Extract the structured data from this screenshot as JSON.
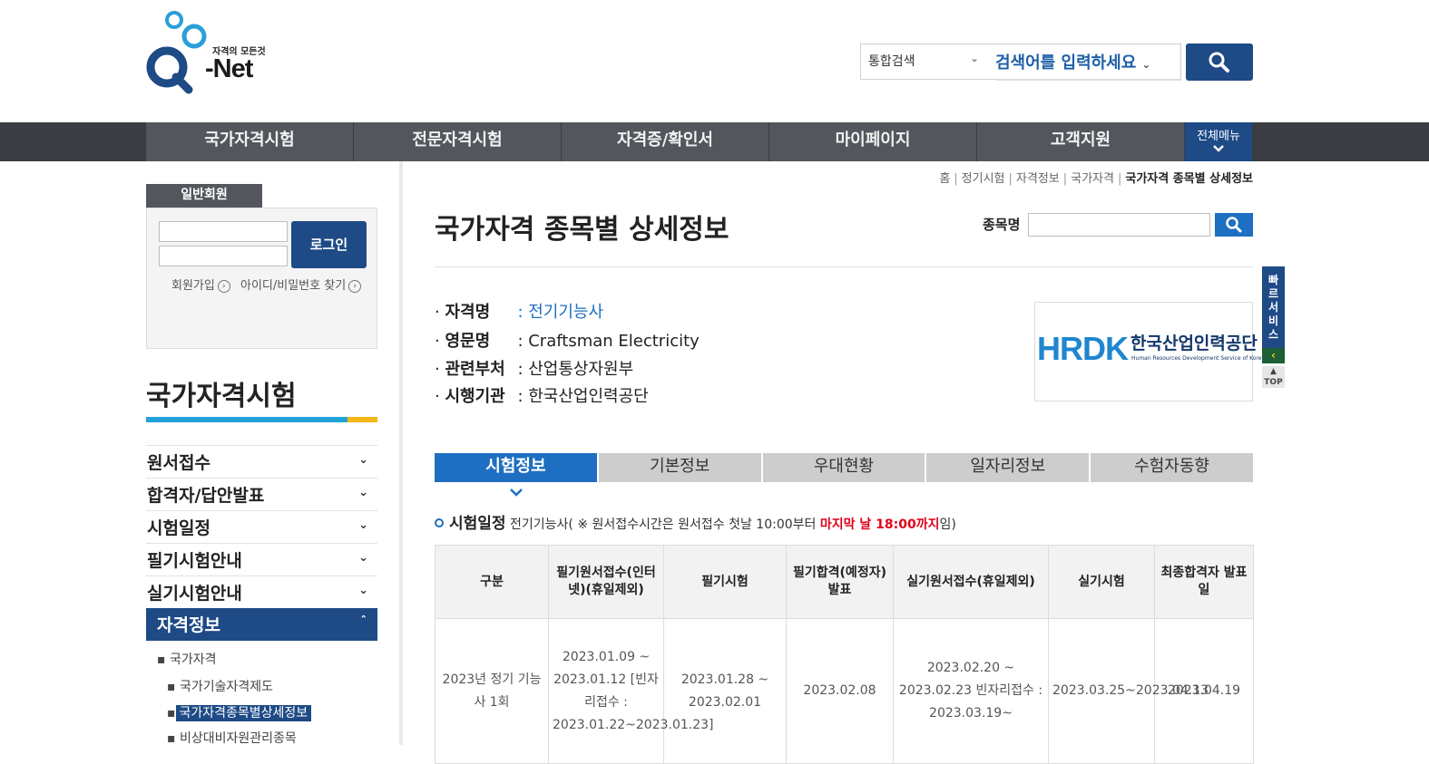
{
  "header": {
    "logo_tagline": "자격의 모든것",
    "logo_text": "-Net",
    "search_scope": "통합검색",
    "search_placeholder": "검색어를 입력하세요"
  },
  "gnb": {
    "items": [
      "국가자격시험",
      "전문자격시험",
      "자격증/확인서",
      "마이페이지",
      "고객지원"
    ],
    "all_menu": "전체메뉴"
  },
  "sidebar": {
    "login_label": "일반회원",
    "login_button": "로그인",
    "signup_link": "회원가입",
    "find_link": "아이디/비밀번호 찾기",
    "section_title": "국가자격시험",
    "menu": [
      "원서접수",
      "합격자/답안발표",
      "시험일정",
      "필기시험안내",
      "실기시험안내"
    ],
    "active_menu": "자격정보",
    "sub_items": [
      "국가자격",
      "국가기술자격제도",
      "국가자격종목별상세정보",
      "비상대비자원관리종목"
    ]
  },
  "breadcrumb": [
    "홈",
    "정기시험",
    "자격정보",
    "국가자격",
    "국가자격 종목별 상세정보"
  ],
  "main": {
    "title": "국가자격 종목별 상세정보",
    "jongmok_label": "종목명",
    "info": [
      {
        "key": "자격명",
        "value": ": 전기기능사"
      },
      {
        "key": "영문명",
        "value": ": Craftsman Electricity"
      },
      {
        "key": "관련부처",
        "value": ": 산업통상자원부"
      },
      {
        "key": "시행기관",
        "value": ": 한국산업인력공단"
      }
    ],
    "hrdk_logo_big": "HRDK",
    "hrdk_logo_kor": "한국산업인력공단",
    "hrdk_logo_eng": "Human Resources Development Service of Korea"
  },
  "quick": {
    "label": "빠르서비스",
    "top": "TOP"
  },
  "tabs": [
    "시험정보",
    "기본정보",
    "우대현황",
    "일자리정보",
    "수험자동향"
  ],
  "schedule": {
    "title": "시험일정",
    "subject": "전기기능사",
    "note_prefix": "( ※ 원서접수시간은 원서접수 첫날 10:00부터 ",
    "note_red": "마지막 날 18:00까지",
    "note_suffix": "임)",
    "headers": [
      "구분",
      "필기원서접수(인터넷)(휴일제외)",
      "필기시험",
      "필기합격(예정자)발표",
      "실기원서접수(휴일제외)",
      "실기시험",
      "최종합격자 발표일"
    ],
    "rows": [
      [
        "2023년 정기 기능사 1회",
        "2023.01.09 ~ 2023.01.12 [빈자리접수 : 2023.01.22~2023.01.23]",
        "2023.01.28 ~ 2023.02.01",
        "2023.02.08",
        "2023.02.20 ~ 2023.02.23 빈자리접수 : 2023.03.19~",
        "2023.03.25~2023.04.13",
        "2023.04.19"
      ]
    ]
  }
}
